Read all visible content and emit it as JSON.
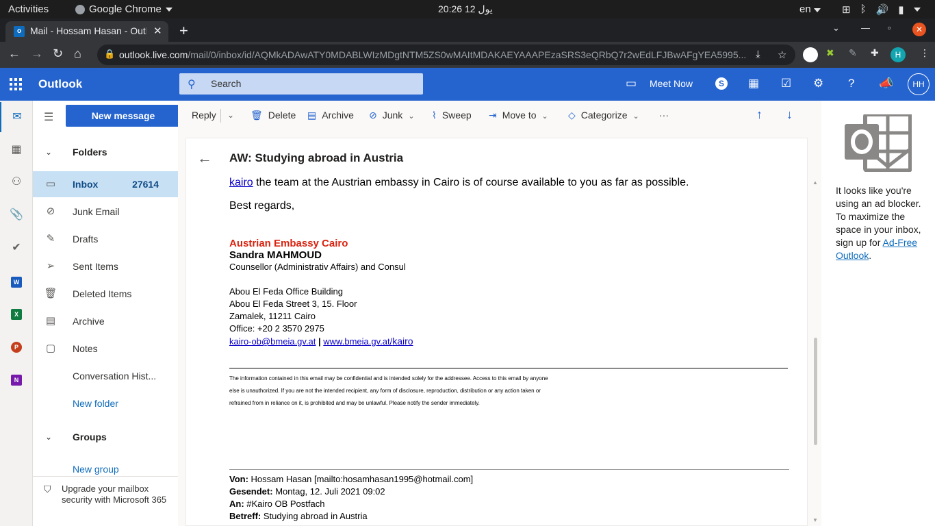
{
  "gnome": {
    "activities": "Activities",
    "app": "Google Chrome",
    "clock": "20:26  يول 12",
    "lang": "en"
  },
  "chrome": {
    "tab_title": "Mail - Hossam Hasan - Outlook",
    "url_host": "outlook.live.com",
    "url_path": "/mail/0/inbox/id/AQMkADAwATY0MDABLWIzMDgtNTM5ZS0wMAItMDAKAEYAAAPEzaSRS3eQRbQ7r2wEdLFJBwAFgYEA5995...",
    "profile_initial": "H"
  },
  "outlook": {
    "brand": "Outlook",
    "search_placeholder": "Search",
    "meet_now": "Meet Now",
    "avatar": "HH",
    "new_message": "New message"
  },
  "folders": {
    "section": "Folders",
    "items": [
      {
        "label": "Inbox",
        "count": "27614"
      },
      {
        "label": "Junk Email"
      },
      {
        "label": "Drafts"
      },
      {
        "label": "Sent Items"
      },
      {
        "label": "Deleted Items"
      },
      {
        "label": "Archive"
      },
      {
        "label": "Notes"
      },
      {
        "label": "Conversation Hist..."
      }
    ],
    "new_folder": "New folder",
    "groups": "Groups",
    "new_group": "New group",
    "upgrade": "Upgrade your mailbox security with Microsoft 365"
  },
  "commands": {
    "reply": "Reply",
    "delete": "Delete",
    "archive": "Archive",
    "junk": "Junk",
    "sweep": "Sweep",
    "move_to": "Move to",
    "categorize": "Categorize",
    "more": "···"
  },
  "message": {
    "subject": "AW: Studying abroad in Austria",
    "line1_link": "kairo",
    "line1_rest": " the team at the Austrian embassy in Cairo is of course available to you as far as possible.",
    "regards": "Best regards,",
    "org": "Austrian Embassy Cairo",
    "name": "Sandra MAHMOUD",
    "title": "Counsellor (Administrativ Affairs) and Consul",
    "addr1": "Abou El Feda Office Building",
    "addr2": "Abou El Feda Street 3, 15. Floor",
    "addr3": "Zamalek, 11211 Cairo",
    "office": "Office: +20 2 3570 2975",
    "email": "kairo-ob@bmeia.gv.at",
    "sep": " | ",
    "web_a": "www.bmeia.gv.at/",
    "web_b": "kairo",
    "disc1": "The information contained in this email may be confidential and is intended solely for the addressee. Access to this email by anyone",
    "disc2": "else is unauthorized. If you are not the intended recipient, any form of disclosure, reproduction, distribution or any action taken or",
    "disc3": "refrained from in reliance on it, is prohibited and may be unlawful. Please notify the sender immediately.",
    "von_k": "Von:",
    "von_v": " Hossam Hasan [mailto:hosamhasan1995@hotmail.com]",
    "ges_k": "Gesendet:",
    "ges_v": " Montag, 12. Juli 2021 09:02",
    "an_k": "An:",
    "an_v": " #Kairo OB Postfach",
    "bet_k": "Betreff:",
    "bet_v": " Studying abroad in Austria"
  },
  "ad": {
    "text": "It looks like you're using an ad blocker. To maximize the space in your inbox, sign up for ",
    "link": "Ad-Free Outlook",
    "end": "."
  },
  "colors": {
    "outlook_blue": "#2564cf",
    "embassy_red": "#d9220f",
    "link": "#0b00c8"
  }
}
